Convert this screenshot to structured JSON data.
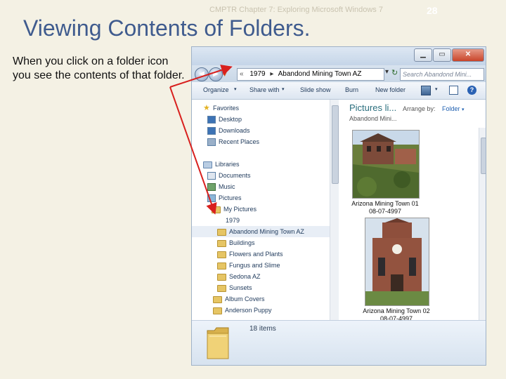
{
  "slide": {
    "header": "CMPTR Chapter 7: Exploring Microsoft Windows 7",
    "page_number": "28",
    "title": "Viewing Contents of Folders.",
    "body": "When you click on a folder icon you see the contents of that folder."
  },
  "window": {
    "address_prefix": "«",
    "breadcrumb_1": "1979",
    "breadcrumb_2": "Abandond Mining Town AZ",
    "search_placeholder": "Search Abandond Mini...",
    "toolbar": [
      "Organize",
      "Share with",
      "Slide show",
      "Burn",
      "New folder"
    ],
    "nav_items": [
      {
        "label": "Favorites",
        "icon": "star-icon"
      },
      {
        "label": "Desktop",
        "icon": "desktop-icon"
      },
      {
        "label": "Downloads",
        "icon": "downloads-icon"
      },
      {
        "label": "Recent Places",
        "icon": "recent-places-icon"
      },
      {
        "label": "Libraries",
        "icon": "library-icon"
      },
      {
        "label": "Documents",
        "icon": "documents-icon"
      },
      {
        "label": "Music",
        "icon": "music-icon"
      },
      {
        "label": "Pictures",
        "icon": "pictures-icon"
      },
      {
        "label": "My Pictures",
        "icon": "folder-icon"
      },
      {
        "label": "1979",
        "icon": "folder-icon"
      },
      {
        "label": "Abandond Mining Town AZ",
        "icon": "folder-icon"
      },
      {
        "label": "Buildings",
        "icon": "folder-icon"
      },
      {
        "label": "Flowers and Plants",
        "icon": "folder-icon"
      },
      {
        "label": "Fungus and Slime",
        "icon": "folder-icon"
      },
      {
        "label": "Sedona AZ",
        "icon": "folder-icon"
      },
      {
        "label": "Sunsets",
        "icon": "folder-icon"
      },
      {
        "label": "Album Covers",
        "icon": "folder-icon"
      },
      {
        "label": "Anderson Puppy",
        "icon": "folder-icon"
      }
    ],
    "library_title": "Pictures li...",
    "library_subtitle": "Abandond Mini...",
    "arrange_label": "Arrange by:",
    "arrange_value": "Folder",
    "photos": [
      {
        "name": "Arizona Mining Town 01",
        "date": "08-07-4997"
      },
      {
        "name": "Arizona Mining Town 02",
        "date": "08-07-4997"
      }
    ],
    "status": "18 items"
  }
}
